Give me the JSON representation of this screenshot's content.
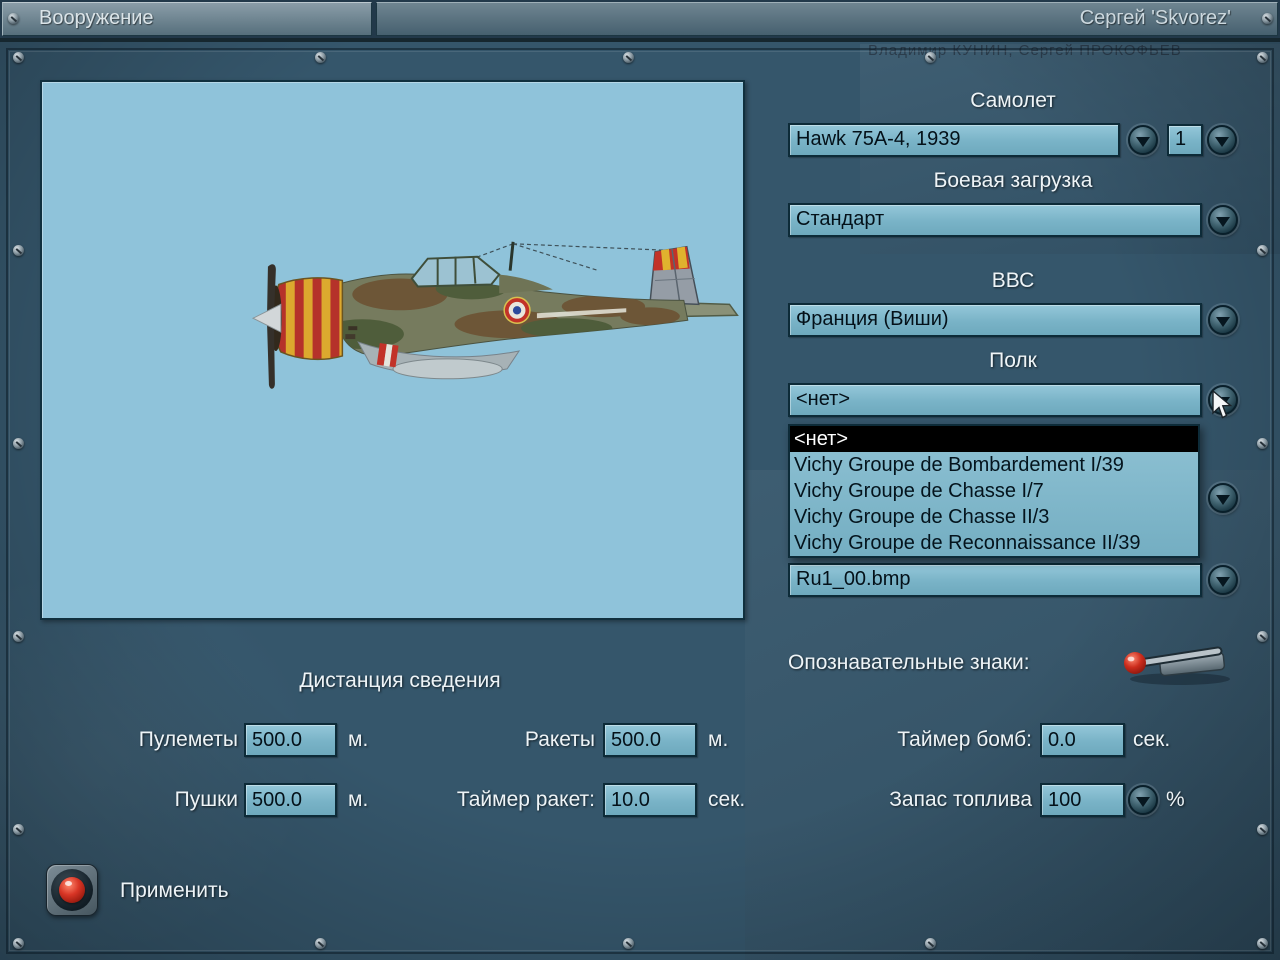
{
  "titlebar": {
    "tab": "Вооружение",
    "player": "Сергей 'Skvorez'"
  },
  "background": {
    "watermark": "Владимир КУНИН, Сергей ПРОКОФЬЕВ"
  },
  "right_panel": {
    "aircraft": {
      "label": "Самолет",
      "value": "Hawk 75A-4, 1939",
      "count": "1"
    },
    "loadout": {
      "label": "Боевая загрузка",
      "value": "Стандарт"
    },
    "airforce": {
      "label": "ВВС",
      "value": "Франция (Виши)"
    },
    "regiment": {
      "label": "Полк",
      "value": "<нет>",
      "options": [
        "<нет>",
        "Vichy Groupe de Bombardement I/39",
        "Vichy Groupe de Chasse I/7",
        "Vichy Groupe de Chasse II/3",
        "Vichy Groupe de Reconnaissance II/39"
      ]
    },
    "skin": {
      "value": "Ru1_00.bmp"
    },
    "markings_label": "Опознавательные знаки:"
  },
  "convergence": {
    "title": "Дистанция сведения",
    "machineguns": {
      "label": "Пулеметы",
      "value": "500.0",
      "unit": "м."
    },
    "cannons": {
      "label": "Пушки",
      "value": "500.0",
      "unit": "м."
    },
    "rockets": {
      "label": "Ракеты",
      "value": "500.0",
      "unit": "м."
    },
    "rocket_timer": {
      "label": "Таймер ракет:",
      "value": "10.0",
      "unit": "сек."
    },
    "bomb_timer": {
      "label": "Таймер бомб:",
      "value": "0.0",
      "unit": "сек."
    },
    "fuel": {
      "label": "Запас топлива",
      "value": "100",
      "unit": "%"
    }
  },
  "apply_label": "Применить",
  "colors": {
    "field_blue": "#79b3c7",
    "panel_bg": "#35566b",
    "accent_red": "#d83525"
  }
}
